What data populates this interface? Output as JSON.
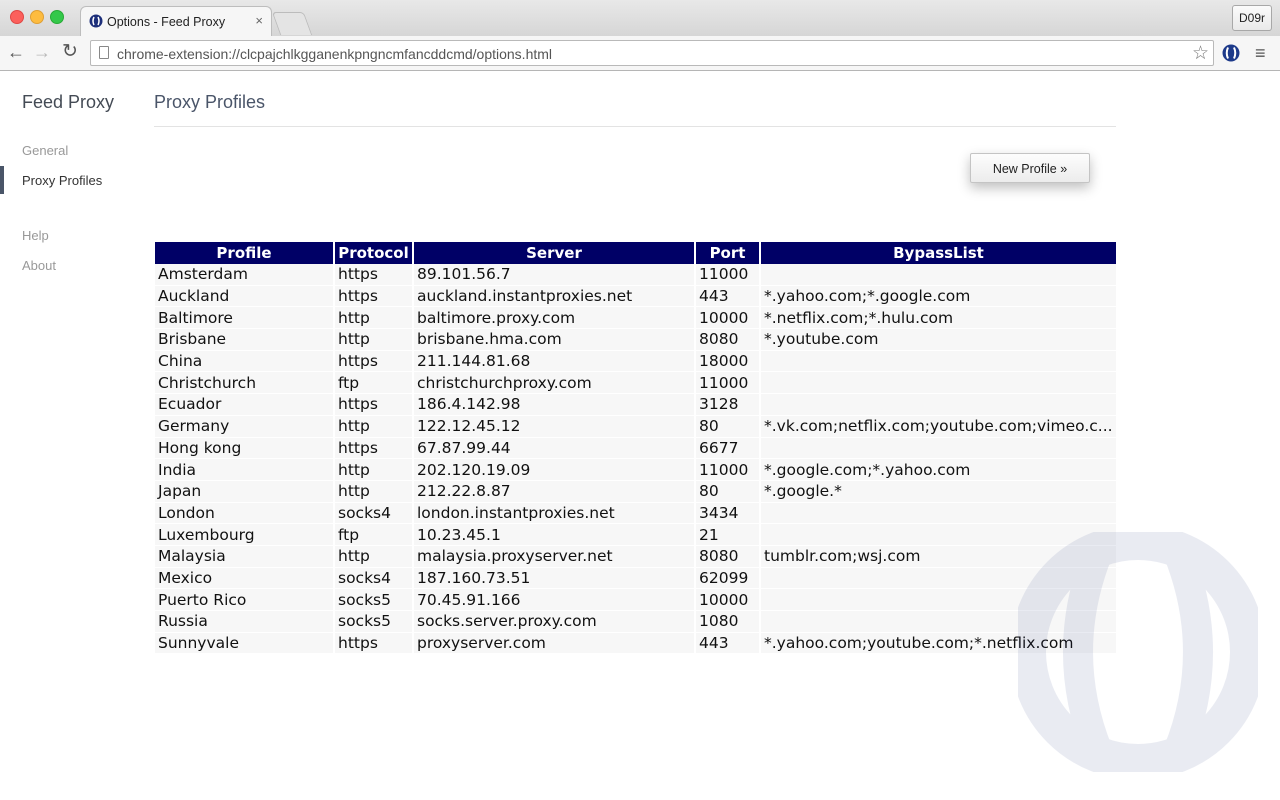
{
  "browser": {
    "tab_title": "Options - Feed Proxy",
    "tab_close": "×",
    "url": "chrome-extension://clcpajchlkgganenkpngncmfancddcmd/options.html",
    "profile_button": "D09r",
    "nav": {
      "back": "←",
      "forward": "→",
      "reload": "↻",
      "star": "☆",
      "menu": "≡"
    }
  },
  "sidebar": {
    "app_title": "Feed Proxy",
    "items": [
      {
        "label": "General"
      },
      {
        "label": "Proxy Profiles"
      },
      {
        "label": "Help"
      },
      {
        "label": "About"
      }
    ]
  },
  "main": {
    "title": "Proxy Profiles",
    "new_profile_label": "New Profile  »",
    "columns": [
      "Profile",
      "Protocol",
      "Server",
      "Port",
      "BypassList"
    ],
    "rows": [
      [
        "Amsterdam",
        "https",
        "89.101.56.7",
        "11000",
        ""
      ],
      [
        "Auckland",
        "https",
        "auckland.instantproxies.net",
        "443",
        "*.yahoo.com;*.google.com"
      ],
      [
        "Baltimore",
        "http",
        "baltimore.proxy.com",
        "10000",
        "*.netflix.com;*.hulu.com"
      ],
      [
        "Brisbane",
        "http",
        "brisbane.hma.com",
        "8080",
        "*.youtube.com"
      ],
      [
        "China",
        "https",
        "211.144.81.68",
        "18000",
        ""
      ],
      [
        "Christchurch",
        "ftp",
        "christchurchproxy.com",
        "11000",
        ""
      ],
      [
        "Ecuador",
        "https",
        "186.4.142.98",
        "3128",
        ""
      ],
      [
        "Germany",
        "http",
        "122.12.45.12",
        "80",
        "*.vk.com;netflix.com;youtube.com;vimeo.c..."
      ],
      [
        "Hong kong",
        "https",
        "67.87.99.44",
        "6677",
        ""
      ],
      [
        "India",
        "http",
        "202.120.19.09",
        "11000",
        "*.google.com;*.yahoo.com"
      ],
      [
        "Japan",
        "http",
        "212.22.8.87",
        "80",
        "*.google.*"
      ],
      [
        "London",
        "socks4",
        "london.instantproxies.net",
        "3434",
        ""
      ],
      [
        "Luxembourg",
        "ftp",
        "10.23.45.1",
        "21",
        ""
      ],
      [
        "Malaysia",
        "http",
        "malaysia.proxyserver.net",
        "8080",
        "tumblr.com;wsj.com"
      ],
      [
        "Mexico",
        "socks4",
        "187.160.73.51",
        "62099",
        ""
      ],
      [
        "Puerto Rico",
        "socks5",
        "70.45.91.166",
        "10000",
        ""
      ],
      [
        "Russia",
        "socks5",
        "socks.server.proxy.com",
        "1080",
        ""
      ],
      [
        "Sunnyvale",
        "https",
        "proxyserver.com",
        "443",
        "*.yahoo.com;youtube.com;*.netflix.com"
      ]
    ]
  },
  "colors": {
    "header_bg": "#000066",
    "row_bg": "#f7f7f7",
    "accent": "#4a5568"
  }
}
